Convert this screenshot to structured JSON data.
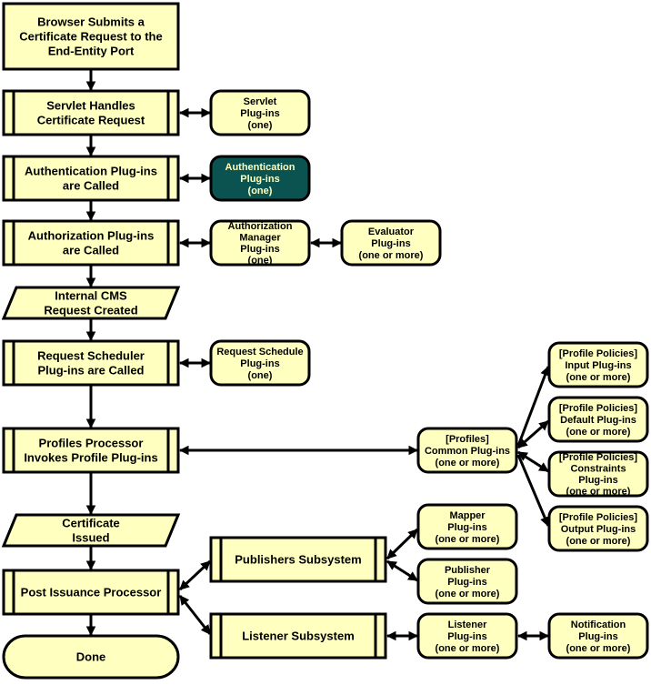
{
  "colors": {
    "fill": "#FFFFC0",
    "stroke": "#000000",
    "highlight_fill": "#0B5350",
    "highlight_text": "#FFFFC0"
  },
  "nodes": [
    {
      "id": "browser-submits",
      "shape": "rect",
      "lines": [
        "Browser Submits a",
        "Certificate Request to the",
        "End-Entity Port"
      ]
    },
    {
      "id": "servlet-handles",
      "shape": "process",
      "lines": [
        "Servlet Handles",
        "Certificate Request"
      ]
    },
    {
      "id": "authentication-called",
      "shape": "process",
      "lines": [
        "Authentication Plug-ins",
        "are Called"
      ]
    },
    {
      "id": "authorization-called",
      "shape": "process",
      "lines": [
        "Authorization Plug-ins",
        "are Called"
      ]
    },
    {
      "id": "internal-cms-request",
      "shape": "data",
      "lines": [
        "Internal CMS",
        "Request Created"
      ]
    },
    {
      "id": "request-scheduler-called",
      "shape": "process",
      "lines": [
        "Request Scheduler",
        "Plug-ins are Called"
      ]
    },
    {
      "id": "profiles-processor",
      "shape": "process",
      "lines": [
        "Profiles Processor",
        "Invokes Profile Plug-ins"
      ]
    },
    {
      "id": "certificate-issued",
      "shape": "data",
      "lines": [
        "Certificate",
        "Issued"
      ]
    },
    {
      "id": "post-issuance",
      "shape": "process",
      "lines": [
        "Post Issuance Processor"
      ]
    },
    {
      "id": "done",
      "shape": "terminator",
      "lines": [
        "Done"
      ]
    },
    {
      "id": "servlet-plugins",
      "shape": "rounded",
      "lines": [
        "Servlet",
        "Plug-ins",
        "(one)"
      ]
    },
    {
      "id": "authentication-plugins",
      "shape": "rounded",
      "highlight": true,
      "lines": [
        "Authentication",
        "Plug-ins",
        "(one)"
      ]
    },
    {
      "id": "authorization-manager-plugins",
      "shape": "rounded",
      "lines": [
        "Authorization",
        "Manager",
        "Plug-ins",
        "(one)"
      ]
    },
    {
      "id": "evaluator-plugins",
      "shape": "rounded",
      "lines": [
        "Evaluator",
        "Plug-ins",
        "(one or more)"
      ]
    },
    {
      "id": "request-schedule-plugins",
      "shape": "rounded",
      "lines": [
        "Request Schedule",
        "Plug-ins",
        "(one)"
      ]
    },
    {
      "id": "profiles-common-plugins",
      "shape": "rounded",
      "lines": [
        "[Profiles]",
        "Common Plug-ins",
        "(one or more)"
      ]
    },
    {
      "id": "input-plugins",
      "shape": "rounded",
      "lines": [
        "[Profile Policies]",
        "Input Plug-ins",
        "(one or more)"
      ]
    },
    {
      "id": "default-plugins",
      "shape": "rounded",
      "lines": [
        "[Profile Policies]",
        "Default Plug-ins",
        "(one or more)"
      ]
    },
    {
      "id": "constraints-plugins",
      "shape": "rounded",
      "lines": [
        "[Profile Policies]",
        "Constraints",
        "Plug-ins",
        "(one or more)"
      ]
    },
    {
      "id": "output-plugins",
      "shape": "rounded",
      "lines": [
        "[Profile Policies]",
        "Output Plug-ins",
        "(one or more)"
      ]
    },
    {
      "id": "publishers-subsystem",
      "shape": "process",
      "lines": [
        "Publishers Subsystem"
      ]
    },
    {
      "id": "listener-subsystem",
      "shape": "process",
      "lines": [
        "Listener Subsystem"
      ]
    },
    {
      "id": "mapper-plugins",
      "shape": "rounded",
      "lines": [
        "Mapper",
        "Plug-ins",
        "(one or more)"
      ]
    },
    {
      "id": "publisher-plugins",
      "shape": "rounded",
      "lines": [
        "Publisher",
        "Plug-ins",
        "(one or more)"
      ]
    },
    {
      "id": "listener-plugins",
      "shape": "rounded",
      "lines": [
        "Listener",
        "Plug-ins",
        "(one or more)"
      ]
    },
    {
      "id": "notification-plugins",
      "shape": "rounded",
      "lines": [
        "Notification",
        "Plug-ins",
        "(one or more)"
      ]
    }
  ],
  "edges": [
    {
      "from": "browser-submits",
      "to": "servlet-handles",
      "both": false
    },
    {
      "from": "servlet-handles",
      "to": "authentication-called",
      "both": false
    },
    {
      "from": "authentication-called",
      "to": "authorization-called",
      "both": false
    },
    {
      "from": "authorization-called",
      "to": "internal-cms-request",
      "both": false
    },
    {
      "from": "internal-cms-request",
      "to": "request-scheduler-called",
      "both": false
    },
    {
      "from": "request-scheduler-called",
      "to": "profiles-processor",
      "both": false
    },
    {
      "from": "profiles-processor",
      "to": "certificate-issued",
      "both": false
    },
    {
      "from": "certificate-issued",
      "to": "post-issuance",
      "both": false
    },
    {
      "from": "post-issuance",
      "to": "done",
      "both": false
    },
    {
      "from": "servlet-handles",
      "to": "servlet-plugins",
      "both": true
    },
    {
      "from": "authentication-called",
      "to": "authentication-plugins",
      "both": true
    },
    {
      "from": "authorization-called",
      "to": "authorization-manager-plugins",
      "both": true
    },
    {
      "from": "authorization-manager-plugins",
      "to": "evaluator-plugins",
      "both": true
    },
    {
      "from": "request-scheduler-called",
      "to": "request-schedule-plugins",
      "both": true
    },
    {
      "from": "profiles-processor",
      "to": "profiles-common-plugins",
      "both": true
    },
    {
      "from": "profiles-common-plugins",
      "to": "input-plugins",
      "both": false
    },
    {
      "from": "profiles-common-plugins",
      "to": "default-plugins",
      "both": true
    },
    {
      "from": "profiles-common-plugins",
      "to": "constraints-plugins",
      "both": true
    },
    {
      "from": "profiles-common-plugins",
      "to": "output-plugins",
      "both": false
    },
    {
      "from": "post-issuance",
      "to": "publishers-subsystem",
      "both": true
    },
    {
      "from": "post-issuance",
      "to": "listener-subsystem",
      "both": true
    },
    {
      "from": "publishers-subsystem",
      "to": "mapper-plugins",
      "both": true
    },
    {
      "from": "publishers-subsystem",
      "to": "publisher-plugins",
      "both": true
    },
    {
      "from": "listener-subsystem",
      "to": "listener-plugins",
      "both": true
    },
    {
      "from": "listener-plugins",
      "to": "notification-plugins",
      "both": true
    }
  ]
}
